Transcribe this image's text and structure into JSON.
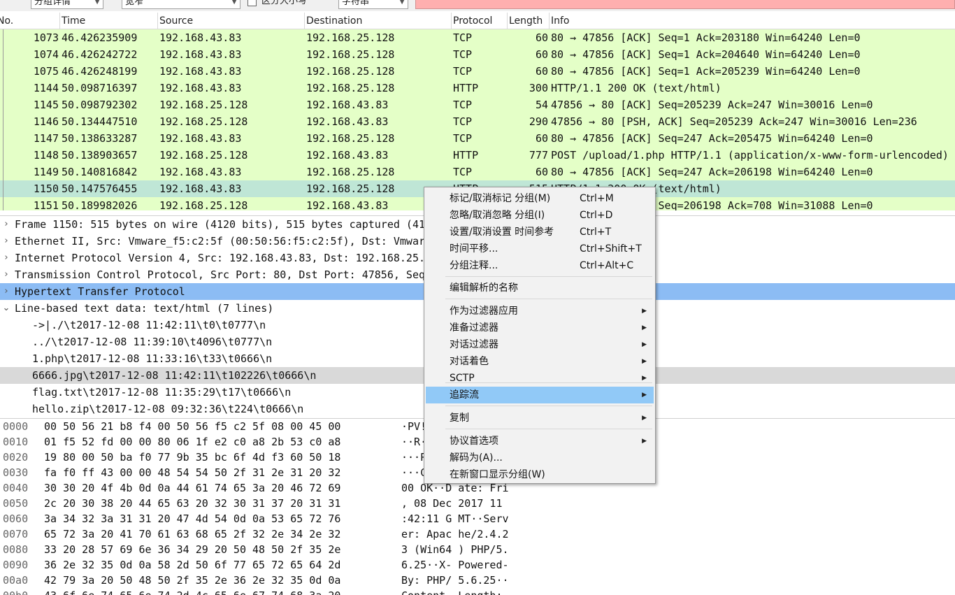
{
  "toolbar": {
    "display_combo": "分组详情",
    "width_combo": "宽窄",
    "case_label": "区分大小写",
    "type_combo": "字符串"
  },
  "columns": [
    "No.",
    "Time",
    "Source",
    "Destination",
    "Protocol",
    "Length",
    "Info"
  ],
  "packets": [
    {
      "no": "1073",
      "time": "46.426235909",
      "src": "192.168.43.83",
      "dst": "192.168.25.128",
      "proto": "TCP",
      "len": "60",
      "info": "80 → 47856 [ACK] Seq=1 Ack=203180 Win=64240 Len=0"
    },
    {
      "no": "1074",
      "time": "46.426242722",
      "src": "192.168.43.83",
      "dst": "192.168.25.128",
      "proto": "TCP",
      "len": "60",
      "info": "80 → 47856 [ACK] Seq=1 Ack=204640 Win=64240 Len=0"
    },
    {
      "no": "1075",
      "time": "46.426248199",
      "src": "192.168.43.83",
      "dst": "192.168.25.128",
      "proto": "TCP",
      "len": "60",
      "info": "80 → 47856 [ACK] Seq=1 Ack=205239 Win=64240 Len=0"
    },
    {
      "no": "1144",
      "time": "50.098716397",
      "src": "192.168.43.83",
      "dst": "192.168.25.128",
      "proto": "HTTP",
      "len": "300",
      "info": "HTTP/1.1 200 OK  (text/html)"
    },
    {
      "no": "1145",
      "time": "50.098792302",
      "src": "192.168.25.128",
      "dst": "192.168.43.83",
      "proto": "TCP",
      "len": "54",
      "info": "47856 → 80 [ACK] Seq=205239 Ack=247 Win=30016 Len=0"
    },
    {
      "no": "1146",
      "time": "50.134447510",
      "src": "192.168.25.128",
      "dst": "192.168.43.83",
      "proto": "TCP",
      "len": "290",
      "info": "47856 → 80 [PSH, ACK] Seq=205239 Ack=247 Win=30016 Len=236"
    },
    {
      "no": "1147",
      "time": "50.138633287",
      "src": "192.168.43.83",
      "dst": "192.168.25.128",
      "proto": "TCP",
      "len": "60",
      "info": "80 → 47856 [ACK] Seq=247 Ack=205475 Win=64240 Len=0"
    },
    {
      "no": "1148",
      "time": "50.138903657",
      "src": "192.168.25.128",
      "dst": "192.168.43.83",
      "proto": "HTTP",
      "len": "777",
      "info": "POST /upload/1.php HTTP/1.1  (application/x-www-form-urlencoded)"
    },
    {
      "no": "1149",
      "time": "50.140816842",
      "src": "192.168.43.83",
      "dst": "192.168.25.128",
      "proto": "TCP",
      "len": "60",
      "info": "80 → 47856 [ACK] Seq=247 Ack=206198 Win=64240 Len=0"
    },
    {
      "no": "1150",
      "time": "50.147576455",
      "src": "192.168.43.83",
      "dst": "192.168.25.128",
      "proto": "HTTP",
      "len": "515",
      "info": "HTTP/1.1 200 OK  (text/html)"
    },
    {
      "no": "1151",
      "time": "50.189982026",
      "src": "192.168.25.128",
      "dst": "192.168.43.83",
      "proto": "TCP",
      "len": "54",
      "info": "47856 → 80 [ACK] Seq=206198 Ack=708 Win=31088 Len=0"
    }
  ],
  "details": [
    {
      "text": "Frame 1150: 515 bytes on wire (4120 bits), 515 bytes captured (4120 bits) on interface 0",
      "expander": "›"
    },
    {
      "text": "Ethernet II, Src: Vmware_f5:c2:5f (00:50:56:f5:c2:5f), Dst: Vmware_21:b8:f4 (00:50:56:21:b8:f4)",
      "expander": "›"
    },
    {
      "text": "Internet Protocol Version 4, Src: 192.168.43.83, Dst: 192.168.25.128",
      "expander": "›"
    },
    {
      "text": "Transmission Control Protocol, Src Port: 80, Dst Port: 47856, Seq: 247, Ack: 206198, Len: 461",
      "expander": "›"
    },
    {
      "text": "Hypertext Transfer Protocol",
      "expander": "›"
    },
    {
      "text": "Line-based text data: text/html (7 lines)",
      "expander": "⌄"
    },
    {
      "text": "->|./\\t2017-12-08 11:42:11\\t0\\t0777\\n",
      "expander": ""
    },
    {
      "text": "../\\t2017-12-08 11:39:10\\t4096\\t0777\\n",
      "expander": ""
    },
    {
      "text": "1.php\\t2017-12-08 11:33:16\\t33\\t0666\\n",
      "expander": ""
    },
    {
      "text": "6666.jpg\\t2017-12-08 11:42:11\\t102226\\t0666\\n",
      "expander": ""
    },
    {
      "text": "flag.txt\\t2017-12-08 11:35:29\\t17\\t0666\\n",
      "expander": ""
    },
    {
      "text": "hello.zip\\t2017-12-08 09:32:36\\t224\\t0666\\n",
      "expander": ""
    }
  ],
  "hex": [
    {
      "off": "0000",
      "bytes": "00 50 56 21 b8 f4 00 50  56 f5 c2 5f 08 00 45 00",
      "ascii": "·PV!···P V··_··E·"
    },
    {
      "off": "0010",
      "bytes": "01 f5 52 fd 00 00 80 06  1f e2 c0 a8 2b 53 c0 a8",
      "ascii": "··R····· ····+S··"
    },
    {
      "off": "0020",
      "bytes": "19 80 00 50 ba f0 77 9b  35 bc 6f 4d f3 60 50 18",
      "ascii": "···P··w· 5·oM·`P·"
    },
    {
      "off": "0030",
      "bytes": "fa f0 ff 43 00 00 48 54  54 50 2f 31 2e 31 20 32",
      "ascii": "···C··HT TP/1.1 2"
    },
    {
      "off": "0040",
      "bytes": "30 30 20 4f 4b 0d 0a 44  61 74 65 3a 20 46 72 69",
      "ascii": "00 OK··D ate: Fri"
    },
    {
      "off": "0050",
      "bytes": "2c 20 30 38 20 44 65 63  20 32 30 31 37 20 31 31",
      "ascii": ", 08 Dec  2017 11"
    },
    {
      "off": "0060",
      "bytes": "3a 34 32 3a 31 31 20 47  4d 54 0d 0a 53 65 72 76",
      "ascii": ":42:11 G MT··Serv"
    },
    {
      "off": "0070",
      "bytes": "65 72 3a 20 41 70 61 63  68 65 2f 32 2e 34 2e 32",
      "ascii": "er: Apac he/2.4.2"
    },
    {
      "off": "0080",
      "bytes": "33 20 28 57 69 6e 36 34  29 20 50 48 50 2f 35 2e",
      "ascii": "3 (Win64 ) PHP/5."
    },
    {
      "off": "0090",
      "bytes": "36 2e 32 35 0d 0a 58 2d  50 6f 77 65 72 65 64 2d",
      "ascii": "6.25··X- Powered-"
    },
    {
      "off": "00a0",
      "bytes": "42 79 3a 20 50 48 50 2f  35 2e 36 2e 32 35 0d 0a",
      "ascii": "By: PHP/ 5.6.25··"
    },
    {
      "off": "00b0",
      "bytes": "43 6f 6e 74 65 6e 74 2d  4c 65 6e 67 74 68 3a 20",
      "ascii": "Content- Length: "
    }
  ],
  "context_menu": {
    "items": [
      {
        "label": "标记/取消标记 分组(M)",
        "shortcut": "Ctrl+M",
        "submenu": false
      },
      {
        "label": "忽略/取消忽略 分组(I)",
        "shortcut": "Ctrl+D",
        "submenu": false
      },
      {
        "label": "设置/取消设置 时间参考",
        "shortcut": "Ctrl+T",
        "submenu": false
      },
      {
        "label": "时间平移...",
        "shortcut": "Ctrl+Shift+T",
        "submenu": false
      },
      {
        "label": "分组注释...",
        "shortcut": "Ctrl+Alt+C",
        "submenu": false
      },
      {
        "label": "编辑解析的名称",
        "shortcut": "",
        "submenu": false
      },
      {
        "label": "作为过滤器应用",
        "shortcut": "",
        "submenu": true
      },
      {
        "label": "准备过滤器",
        "shortcut": "",
        "submenu": true
      },
      {
        "label": "对话过滤器",
        "shortcut": "",
        "submenu": true
      },
      {
        "label": "对话着色",
        "shortcut": "",
        "submenu": true
      },
      {
        "label": "SCTP",
        "shortcut": "",
        "submenu": true
      },
      {
        "label": "追踪流",
        "shortcut": "",
        "submenu": true
      },
      {
        "label": "复制",
        "shortcut": "",
        "submenu": true
      },
      {
        "label": "协议首选项",
        "shortcut": "",
        "submenu": true
      },
      {
        "label": "解码为(A)...",
        "shortcut": "",
        "submenu": false
      },
      {
        "label": "在新窗口显示分组(W)",
        "shortcut": "",
        "submenu": false
      }
    ],
    "submenu_arrow": "▶"
  },
  "colors": {
    "row_green": "#e4ffc7",
    "row_selected": "#bfe6d6",
    "detail_highlight": "#8cbcf4",
    "menu_active": "#91c9f7",
    "find_field": "#ffafaf"
  }
}
